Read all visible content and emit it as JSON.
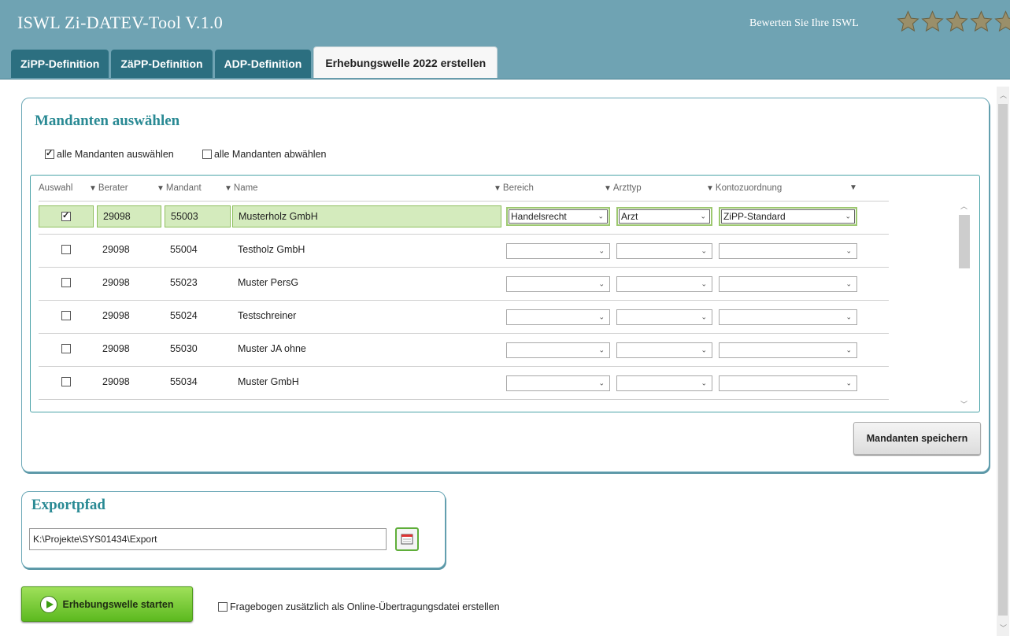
{
  "app": {
    "title": "ISWL Zi-DATEV-Tool V.1.0",
    "rate_label": "Bewerten Sie Ihre ISWL",
    "rating_stars": 5,
    "colors": {
      "header": "#6fa3b3",
      "tab": "#2c6f80",
      "accent": "#2a8a94",
      "selected_row": "#d4ebbd",
      "start_button": "#6cc52a"
    }
  },
  "tabs": [
    {
      "label": "ZiPP-Definition",
      "active": false
    },
    {
      "label": "ZäPP-Definition",
      "active": false
    },
    {
      "label": "ADP-Definition",
      "active": false
    },
    {
      "label": "Erhebungswelle 2022 erstellen",
      "active": true
    }
  ],
  "mandanten": {
    "title": "Mandanten auswählen",
    "select_all": {
      "label": "alle Mandanten auswählen",
      "checked": true
    },
    "deselect_all": {
      "label": "alle Mandanten abwählen",
      "checked": false
    },
    "columns": [
      "Auswahl",
      "Berater",
      "Mandant",
      "Name",
      "Bereich",
      "Arzttyp",
      "Kontozuordnung",
      ""
    ],
    "rows": [
      {
        "selected": true,
        "berater": "29098",
        "mandant": "55003",
        "name": "Musterholz GmbH",
        "bereich": "Handelsrecht",
        "arzttyp": "Arzt",
        "konto": "ZiPP-Standard"
      },
      {
        "selected": false,
        "berater": "29098",
        "mandant": "55004",
        "name": "Testholz GmbH",
        "bereich": "",
        "arzttyp": "",
        "konto": ""
      },
      {
        "selected": false,
        "berater": "29098",
        "mandant": "55023",
        "name": "Muster PersG",
        "bereich": "",
        "arzttyp": "",
        "konto": ""
      },
      {
        "selected": false,
        "berater": "29098",
        "mandant": "55024",
        "name": "Testschreiner",
        "bereich": "",
        "arzttyp": "",
        "konto": ""
      },
      {
        "selected": false,
        "berater": "29098",
        "mandant": "55030",
        "name": "Muster JA ohne",
        "bereich": "",
        "arzttyp": "",
        "konto": ""
      },
      {
        "selected": false,
        "berater": "29098",
        "mandant": "55034",
        "name": "Muster GmbH",
        "bereich": "",
        "arzttyp": "",
        "konto": ""
      }
    ],
    "save_button": "Mandanten speichern"
  },
  "export": {
    "title": "Exportpfad",
    "path": "K:\\Projekte\\SYS01434\\Export",
    "browse_icon": "calendar-folder-icon"
  },
  "footer": {
    "start_button": "Erhebungswelle starten",
    "online_checkbox": {
      "label": "Fragebogen zusätzlich als Online-Übertragungsdatei erstellen",
      "checked": false
    }
  }
}
